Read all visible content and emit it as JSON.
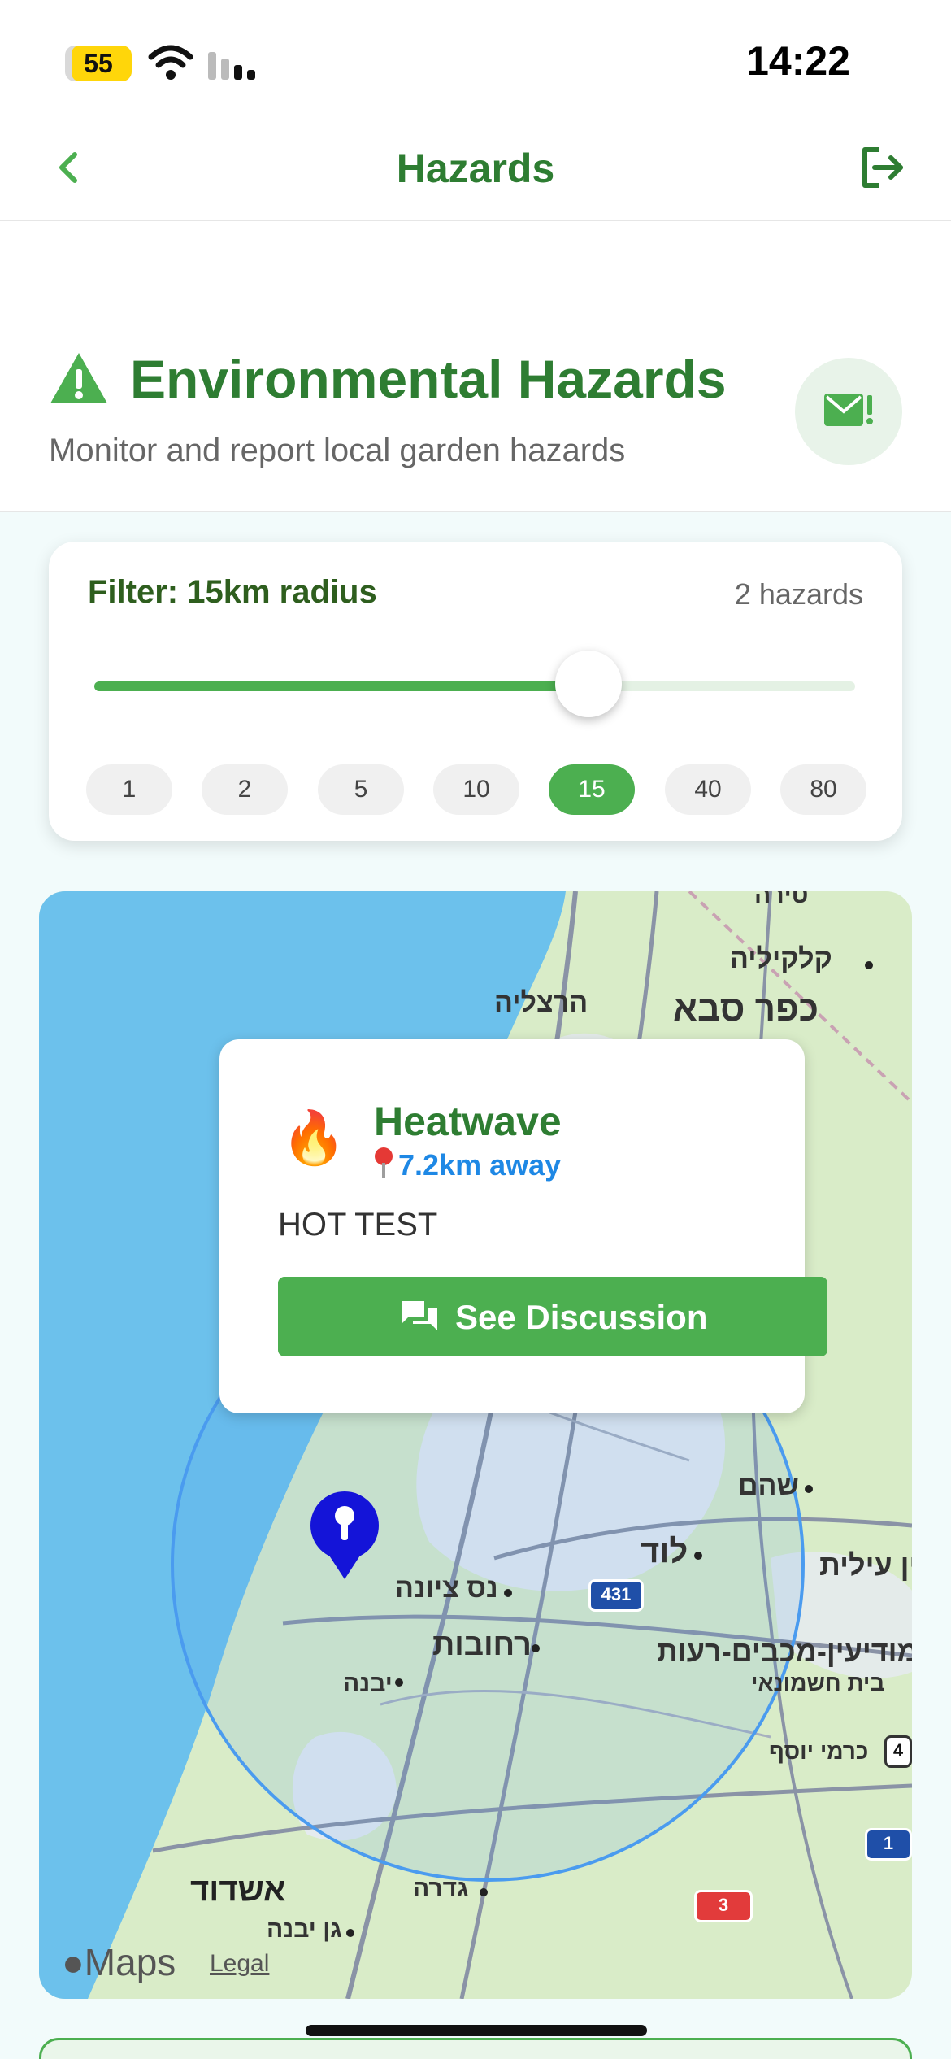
{
  "status_bar": {
    "battery": "55",
    "time": "14:22"
  },
  "nav": {
    "title": "Hazards",
    "back_icon": "chevron-left-icon",
    "logout_icon": "logout-icon"
  },
  "header": {
    "title": "Environmental Hazards",
    "subtitle": "Monitor and report local garden hazards",
    "mail_icon": "mail-alert-icon"
  },
  "filter": {
    "label": "Filter: 15km radius",
    "count": "2 hazards",
    "slider_fraction": 0.65,
    "options": [
      "1",
      "2",
      "5",
      "10",
      "15",
      "40",
      "80"
    ],
    "selected": "15"
  },
  "map": {
    "labels": [
      "קלקיליה",
      "כפר סבא",
      "הרצליה",
      "שהם",
      "לוד",
      "נס ציונה",
      "רחובות",
      "יבנה",
      "אשדוד",
      "גדרה",
      "גן יבנה",
      "מודיעין-מכבים-רעות",
      "בית חשמונאי",
      "כרמי יוסף",
      "ין עילית",
      "טירה"
    ],
    "road_shields": [
      "431",
      "3",
      "1",
      "4"
    ],
    "attribution": "Maps",
    "legal": "Legal"
  },
  "popup": {
    "emoji": "🔥",
    "title": "Heatwave",
    "distance": "7.2km away",
    "description": "HOT TEST",
    "button_label": "See Discussion"
  },
  "colors": {
    "accent": "#4caf50",
    "title_green": "#2e7d32",
    "link_blue": "#1e88e5"
  }
}
